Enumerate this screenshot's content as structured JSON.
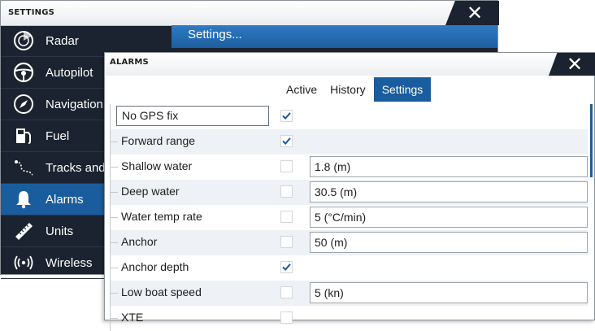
{
  "settings_window": {
    "title": "SETTINGS",
    "close_glyph": "✕",
    "content_header": "Settings...",
    "sidebar": [
      {
        "label": "Radar",
        "icon": "radar-icon"
      },
      {
        "label": "Autopilot",
        "icon": "steering-wheel-icon"
      },
      {
        "label": "Navigation",
        "icon": "compass-icon"
      },
      {
        "label": "Fuel",
        "icon": "fuel-pump-icon"
      },
      {
        "label": "Tracks and Tr",
        "icon": "tracks-icon"
      },
      {
        "label": "Alarms",
        "icon": "bell-icon",
        "active": true
      },
      {
        "label": "Units",
        "icon": "ruler-icon"
      },
      {
        "label": "Wireless",
        "icon": "wireless-icon"
      }
    ]
  },
  "alarms_window": {
    "title": "ALARMS",
    "close_glyph": "✕",
    "tabs": [
      {
        "label": "Active",
        "active": false
      },
      {
        "label": "History",
        "active": false
      },
      {
        "label": "Settings",
        "active": true
      }
    ],
    "rows": [
      {
        "label": "No GPS fix",
        "checked": true,
        "value": null
      },
      {
        "label": "Forward range",
        "checked": true,
        "value": null
      },
      {
        "label": "Shallow water",
        "checked": false,
        "value": "1.8 (m)"
      },
      {
        "label": "Deep water",
        "checked": false,
        "value": "30.5 (m)"
      },
      {
        "label": "Water temp rate",
        "checked": false,
        "value": "5 (°C/min)"
      },
      {
        "label": "Anchor",
        "checked": false,
        "value": "50 (m)"
      },
      {
        "label": "Anchor depth",
        "checked": true,
        "value": null
      },
      {
        "label": "Low boat speed",
        "checked": false,
        "value": "5 (kn)"
      },
      {
        "label": "XTE",
        "checked": false,
        "value": null
      }
    ]
  },
  "colors": {
    "accent": "#1a5d9e",
    "dark_bg": "#1b2330",
    "check": "#1a5d9e"
  }
}
